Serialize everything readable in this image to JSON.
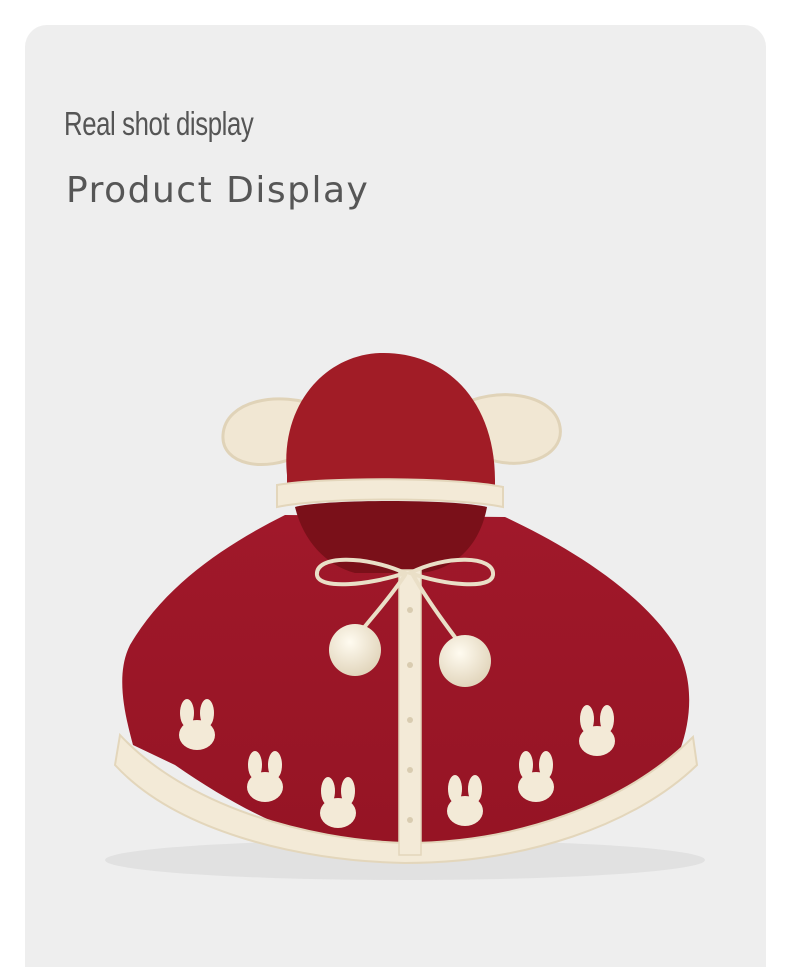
{
  "header": {
    "title": "Real shot display",
    "subtitle": "Product Display"
  },
  "product": {
    "image": "product-photo",
    "main_color": "#a11c26",
    "trim_color": "#f3ead7"
  }
}
